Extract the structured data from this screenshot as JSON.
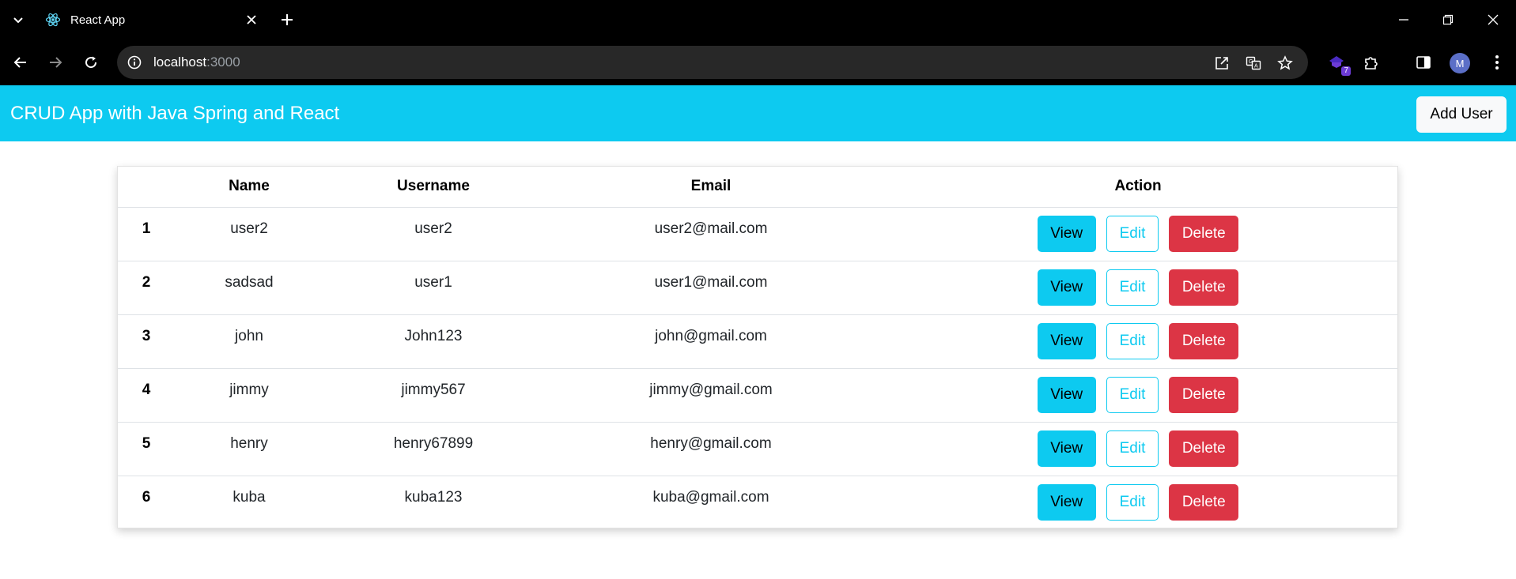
{
  "browser": {
    "tab_title": "React App",
    "url_host": "localhost",
    "url_port": ":3000",
    "extension_badge": "7",
    "profile_initial": "M",
    "icons": [
      "tab-search-icon",
      "react-favicon",
      "close-icon",
      "plus-icon",
      "minimize-icon",
      "restore-icon",
      "close-window-icon",
      "back-icon",
      "forward-icon",
      "reload-icon",
      "site-info-icon",
      "open-in-app-icon",
      "translate-icon",
      "bookmark-star-icon",
      "extension-icon",
      "puzzle-icon",
      "side-panel-icon",
      "menu-icon"
    ]
  },
  "navbar": {
    "brand": "CRUD App with Java Spring and React",
    "add_user_label": "Add User"
  },
  "table": {
    "headers": [
      "",
      "Name",
      "Username",
      "Email",
      "Action"
    ],
    "rows": [
      {
        "index": "1",
        "name": "user2",
        "username": "user2",
        "email": "user2@mail.com"
      },
      {
        "index": "2",
        "name": "sadsad",
        "username": "user1",
        "email": "user1@mail.com"
      },
      {
        "index": "3",
        "name": "john",
        "username": "John123",
        "email": "john@gmail.com"
      },
      {
        "index": "4",
        "name": "jimmy",
        "username": "jimmy567",
        "email": "jimmy@gmail.com"
      },
      {
        "index": "5",
        "name": "henry",
        "username": "henry67899",
        "email": "henry@gmail.com"
      },
      {
        "index": "6",
        "name": "kuba",
        "username": "kuba123",
        "email": "kuba@gmail.com"
      }
    ],
    "actions": {
      "view": "View",
      "edit": "Edit",
      "delete": "Delete"
    }
  },
  "colors": {
    "navbar_bg": "#0dcaf0",
    "view_button": "#0dcaf0",
    "edit_outline": "#0dcaf0",
    "delete_button": "#dc3545",
    "chrome_bg": "#000000",
    "omnibox_bg": "#282828"
  }
}
